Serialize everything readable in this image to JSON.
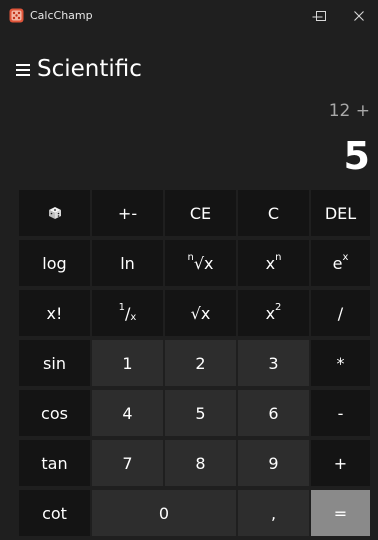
{
  "window": {
    "title": "CalcChamp",
    "minimize_glyph": "—",
    "maximize_glyph": "☐",
    "close_glyph": "✕",
    "icon": "app-icon-dice"
  },
  "header": {
    "menu_icon": "hamburger-menu-icon",
    "mode": "Scientific"
  },
  "display": {
    "expression": "12 +",
    "result": "5"
  },
  "colors": {
    "background": "#1f1f1f",
    "function_key": "#141414",
    "number_key": "#2d2d2d",
    "equals_key": "#8a8a8a",
    "app_icon": "#e0553a"
  },
  "keys": {
    "random": "random-dice-icon",
    "plus_minus": "+-",
    "ce": "CE",
    "c": "C",
    "del": "DEL",
    "log": "log",
    "ln": "ln",
    "nth_root_n": "n",
    "nth_root_body": "√x",
    "power_base": "x",
    "power_exp": "n",
    "exp_base": "e",
    "exp_exp": "x",
    "factorial": "x!",
    "reciprocal_num": "1",
    "reciprocal_slash": "/",
    "reciprocal_den": "x",
    "sqrt": "√x",
    "square_base": "x",
    "square_exp": "2",
    "divide": "/",
    "sin": "sin",
    "one": "1",
    "two": "2",
    "three": "3",
    "multiply": "*",
    "cos": "cos",
    "four": "4",
    "five": "5",
    "six": "6",
    "minus": "-",
    "tan": "tan",
    "seven": "7",
    "eight": "8",
    "nine": "9",
    "plus": "+",
    "cot": "cot",
    "zero": "0",
    "decimal": ",",
    "equals": "="
  }
}
